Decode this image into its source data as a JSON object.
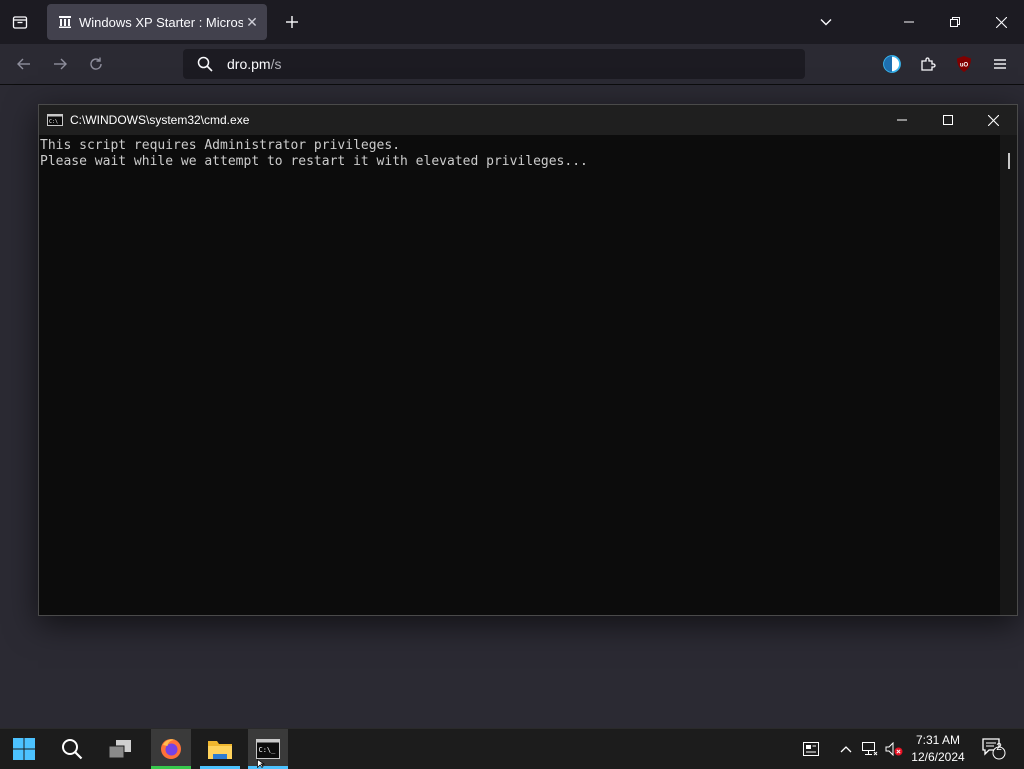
{
  "browser": {
    "tab_title": "Windows XP Starter : Microsoft",
    "url_domain": "dro.pm",
    "url_path": "/s"
  },
  "cmd": {
    "title": "C:\\WINDOWS\\system32\\cmd.exe",
    "lines": [
      "This script requires Administrator privileges.",
      "Please wait while we attempt to restart it with elevated privileges..."
    ]
  },
  "taskbar": {
    "time": "7:31 AM",
    "date": "12/6/2024",
    "notification_count": "2"
  },
  "colors": {
    "firefox_indicator": "#37c84d",
    "explorer_indicator": "#4cc2ff",
    "cmd_indicator": "#4cc2ff",
    "ublock": "#800000"
  }
}
